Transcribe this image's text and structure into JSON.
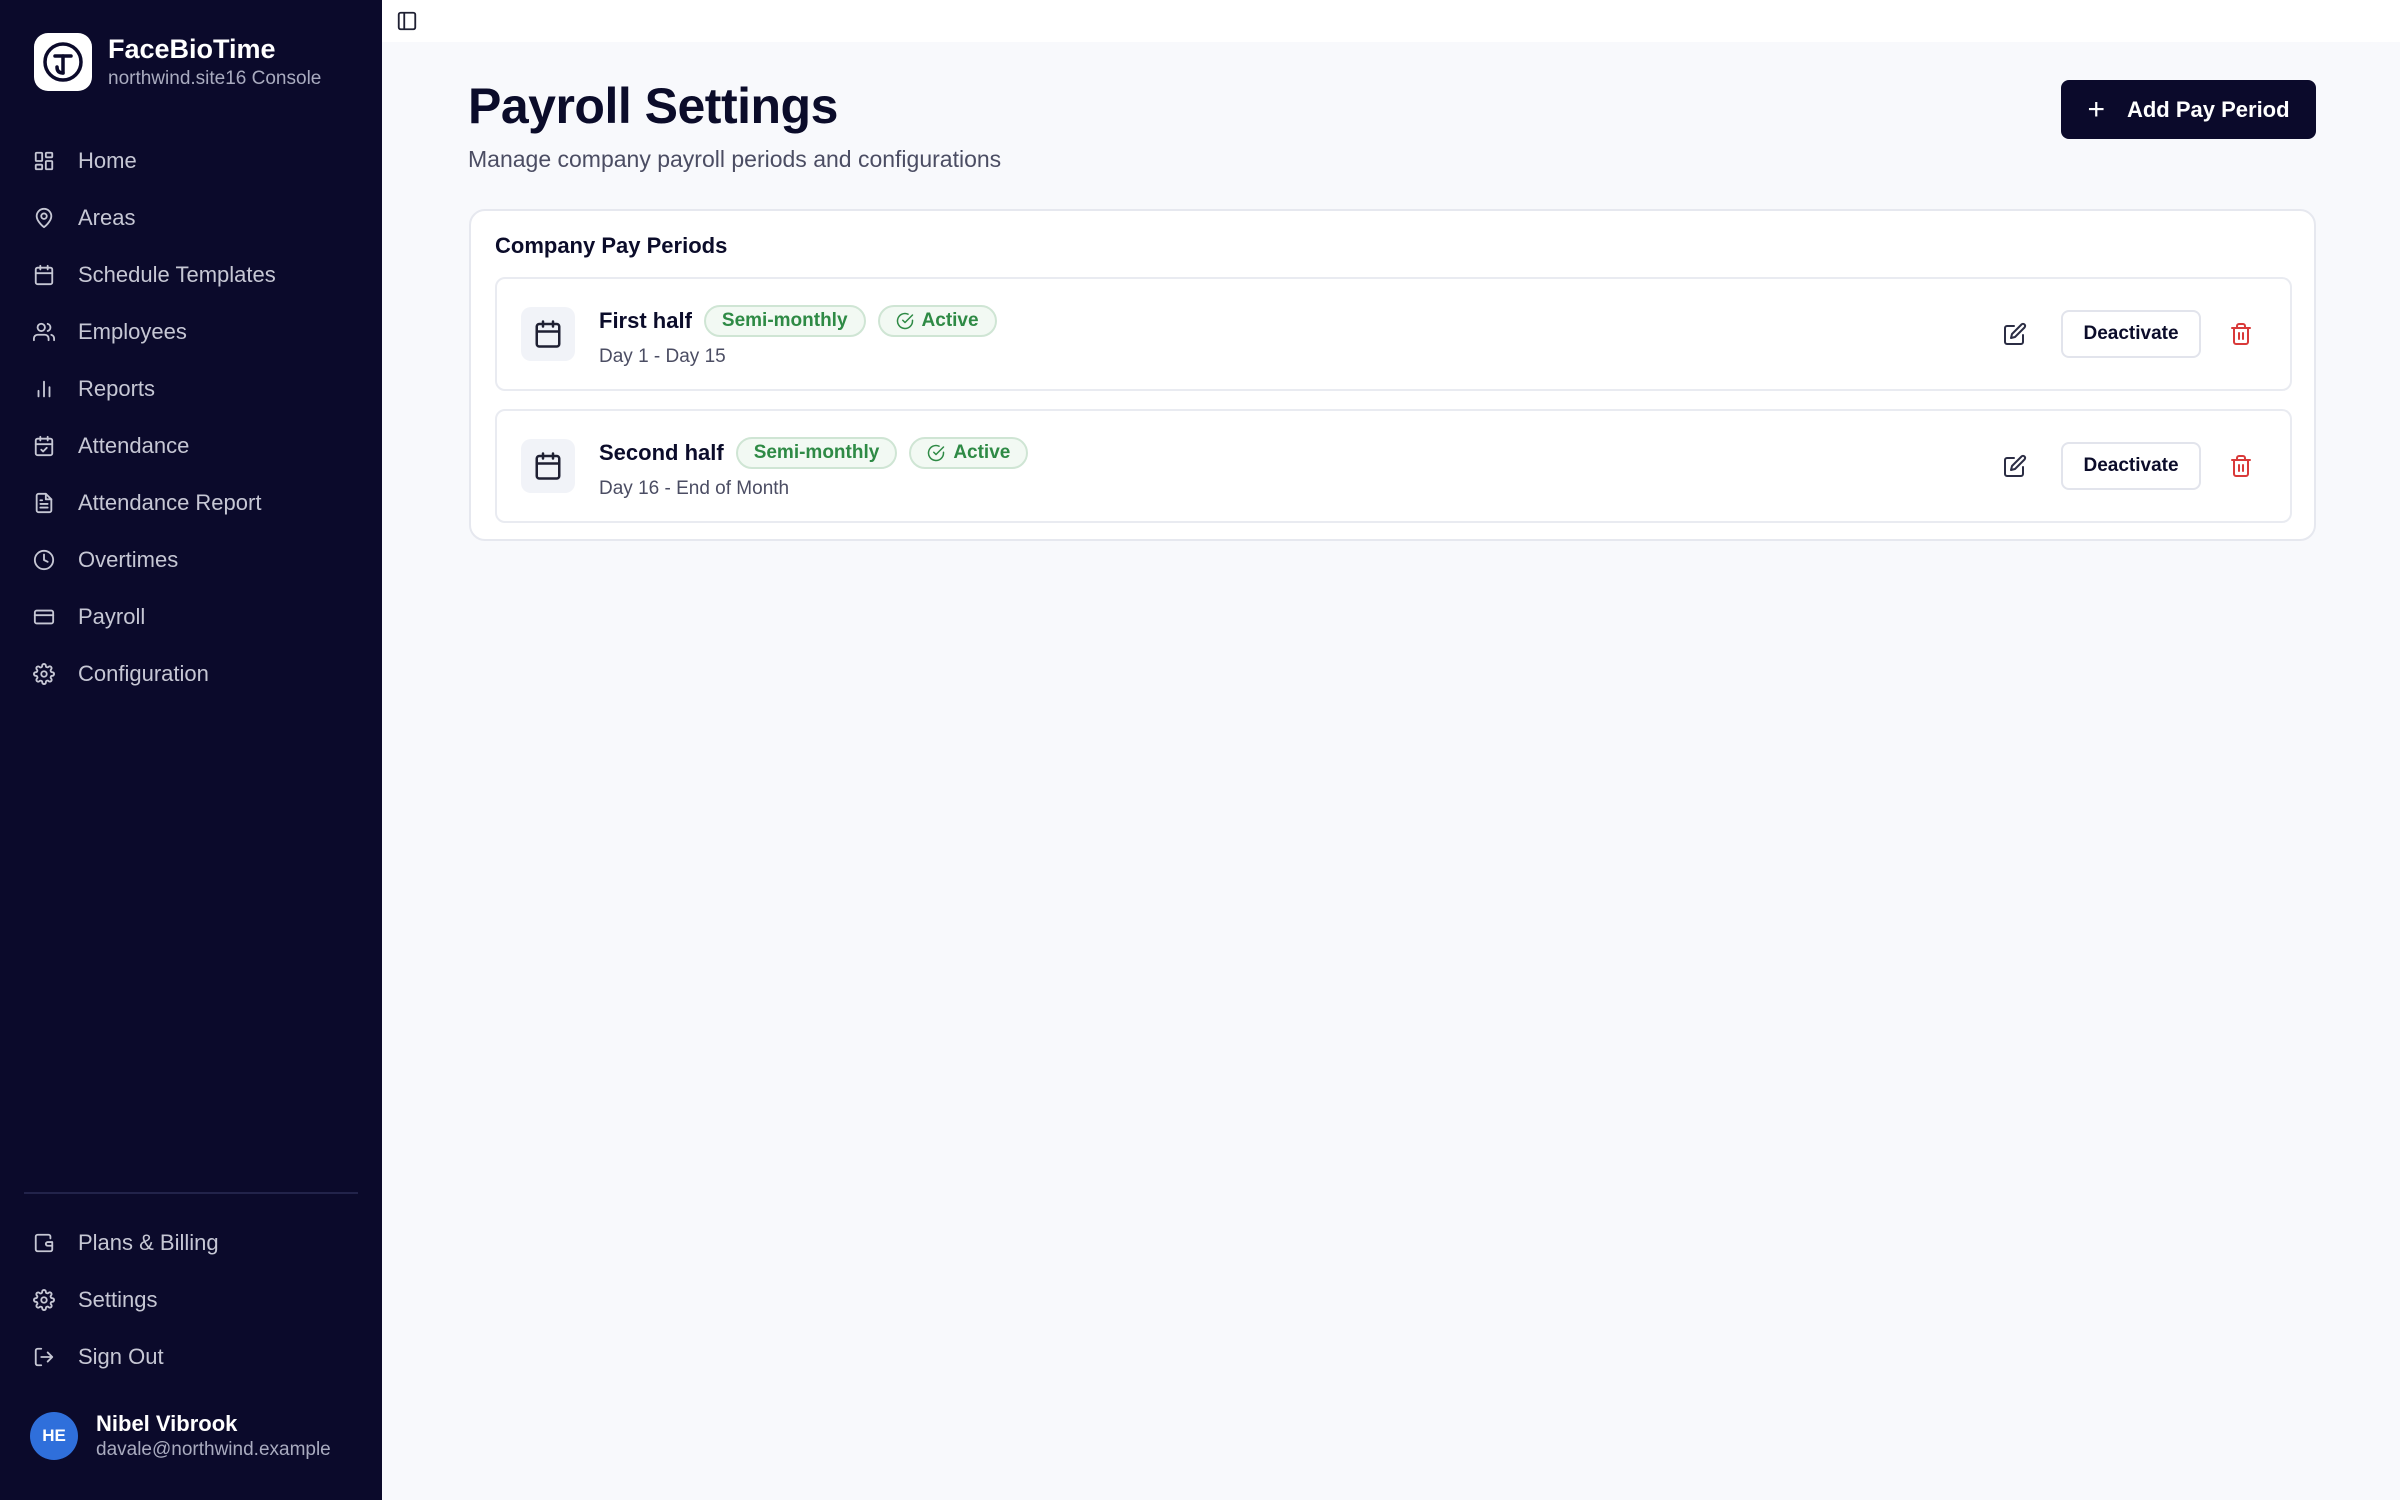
{
  "brand": {
    "name": "FaceBioTime",
    "subtitle": "northwind.site16 Console"
  },
  "sidebar": {
    "items": [
      {
        "label": "Home",
        "icon": "grid-icon"
      },
      {
        "label": "Areas",
        "icon": "map-pin-icon"
      },
      {
        "label": "Schedule Templates",
        "icon": "calendar-icon"
      },
      {
        "label": "Employees",
        "icon": "users-icon"
      },
      {
        "label": "Reports",
        "icon": "bar-chart-icon"
      },
      {
        "label": "Attendance",
        "icon": "calendar-check-icon"
      },
      {
        "label": "Attendance Report",
        "icon": "file-text-icon"
      },
      {
        "label": "Overtimes",
        "icon": "clock-icon"
      },
      {
        "label": "Payroll",
        "icon": "credit-card-icon"
      },
      {
        "label": "Configuration",
        "icon": "gear-icon"
      }
    ],
    "bottom_items": [
      {
        "label": "Plans & Billing",
        "icon": "wallet-icon"
      },
      {
        "label": "Settings",
        "icon": "gear-icon"
      },
      {
        "label": "Sign Out",
        "icon": "log-out-icon"
      }
    ],
    "user": {
      "initials": "HE",
      "name": "Nibel Vibrook",
      "email": "davale@northwind.example"
    }
  },
  "header": {
    "title": "Payroll Settings",
    "subtitle": "Manage company payroll periods and configurations",
    "add_button_label": "Add Pay Period"
  },
  "card": {
    "title": "Company Pay Periods",
    "periods": [
      {
        "name": "First half",
        "type": "Semi-monthly",
        "status": "Active",
        "range": "Day 1 - Day 15",
        "action_label": "Deactivate"
      },
      {
        "name": "Second half",
        "type": "Semi-monthly",
        "status": "Active",
        "range": "Day 16 - End of Month",
        "action_label": "Deactivate"
      }
    ]
  },
  "colors": {
    "sidebar_bg": "#0b0a2b",
    "primary": "#0b0a2b",
    "success": "#2e8a45",
    "danger": "#d93a3a",
    "avatar": "#2f6fdb"
  }
}
